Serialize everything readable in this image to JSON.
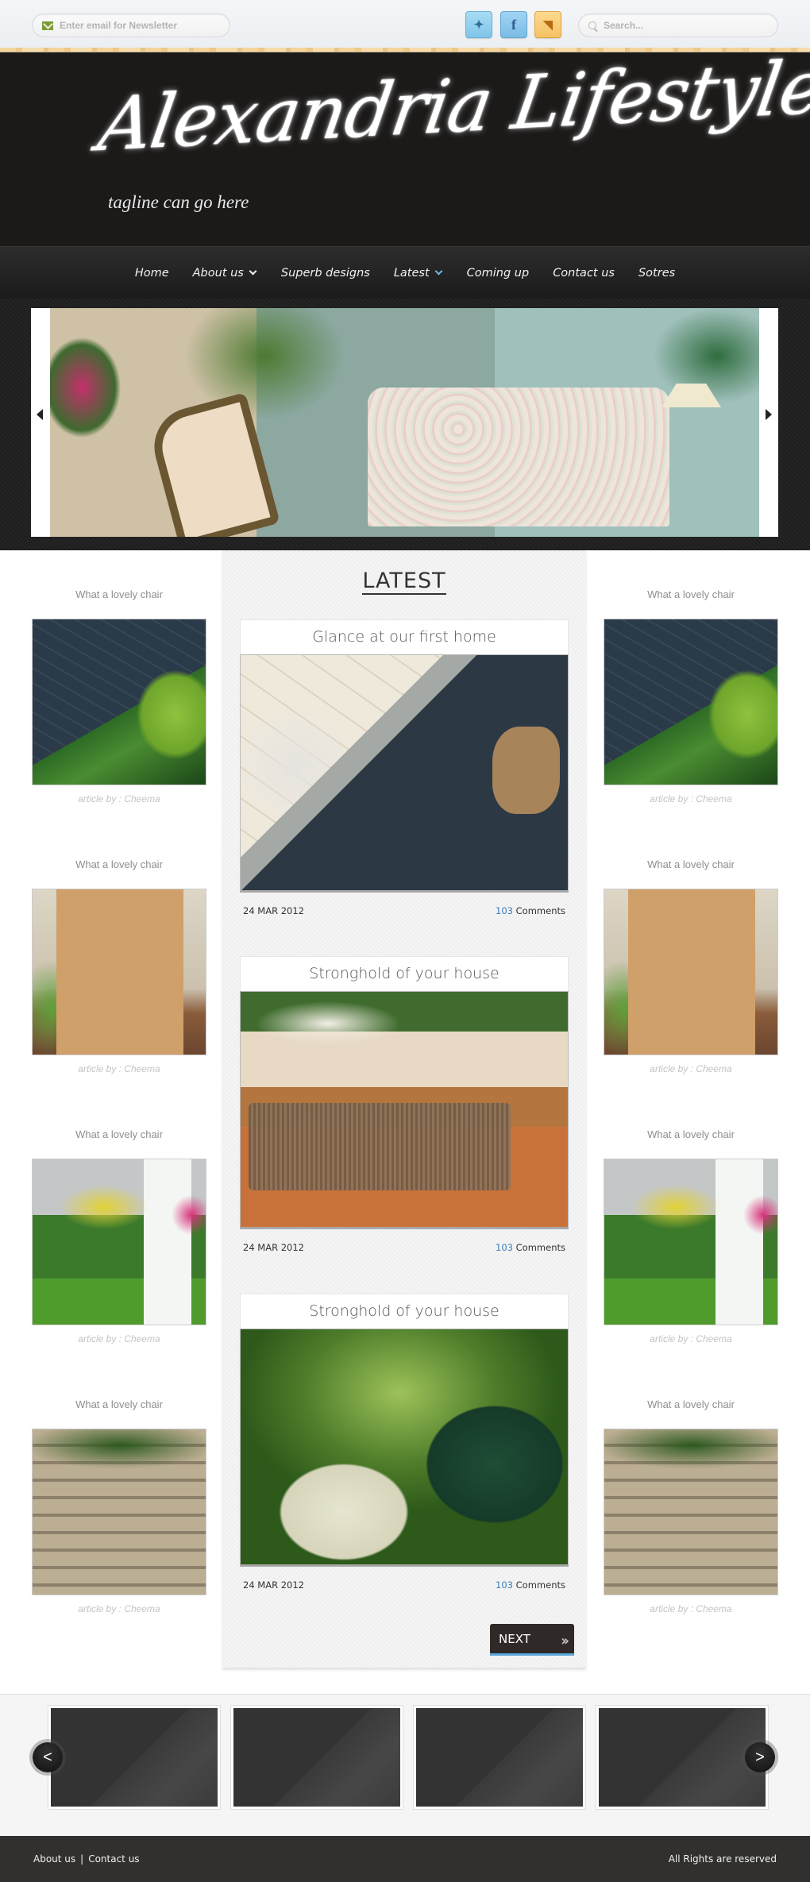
{
  "topbar": {
    "newsletter_placeholder": "Enter email for Newsletter",
    "search_placeholder": "Search...",
    "social": [
      {
        "name": "twitter",
        "glyph": "🐦"
      },
      {
        "name": "facebook",
        "glyph": "f"
      },
      {
        "name": "rss",
        "glyph": "◥"
      }
    ]
  },
  "header": {
    "logo": "Alexandria Lifestyle",
    "tagline": "tagline can go here"
  },
  "nav": {
    "items": [
      {
        "label": "Home"
      },
      {
        "label": "About us",
        "dropdown": true
      },
      {
        "label": "Superb designs"
      },
      {
        "label": "Latest",
        "dropdown": true,
        "active": true
      },
      {
        "label": "Coming up"
      },
      {
        "label": "Contact us"
      },
      {
        "label": "Sotres"
      }
    ]
  },
  "slider": {
    "prev": "‹",
    "next": "›"
  },
  "sidebar_left": [
    {
      "title": "What a lovely chair",
      "byline": "article by : Cheema"
    },
    {
      "title": "What a lovely chair",
      "byline": "article by : Cheema"
    },
    {
      "title": "What a lovely chair",
      "byline": "article by : Cheema"
    },
    {
      "title": "What a lovely chair",
      "byline": "article by : Cheema"
    }
  ],
  "sidebar_right": [
    {
      "title": "What a lovely chair",
      "byline": "article by : Cheema"
    },
    {
      "title": "What a lovely chair",
      "byline": "article by : Cheema"
    },
    {
      "title": "What a lovely chair",
      "byline": "article by : Cheema"
    },
    {
      "title": "What a lovely chair",
      "byline": "article by : Cheema"
    }
  ],
  "latest": {
    "heading": "LATEST",
    "posts": [
      {
        "title": "Glance at our first home",
        "date": "24 MAR 2012",
        "comment_count": "103",
        "comment_label": "Comments"
      },
      {
        "title": "Stronghold of your house",
        "date": "24 MAR 2012",
        "comment_count": "103",
        "comment_label": "Comments"
      },
      {
        "title": "Stronghold of your house",
        "date": "24 MAR 2012",
        "comment_count": "103",
        "comment_label": "Comments"
      }
    ],
    "next_label": "NEXT",
    "next_icon": "»"
  },
  "carousel": {
    "prev": "<",
    "next": ">"
  },
  "footer": {
    "links": [
      "About us",
      "Contact us"
    ],
    "separator": "|",
    "copyright": "All Rights are reserved"
  },
  "colors": {
    "accent_blue": "#3b7db9",
    "next_underline": "#5aa6d8",
    "header_bg": "#1c1a19",
    "footer_bg": "#31302e"
  }
}
